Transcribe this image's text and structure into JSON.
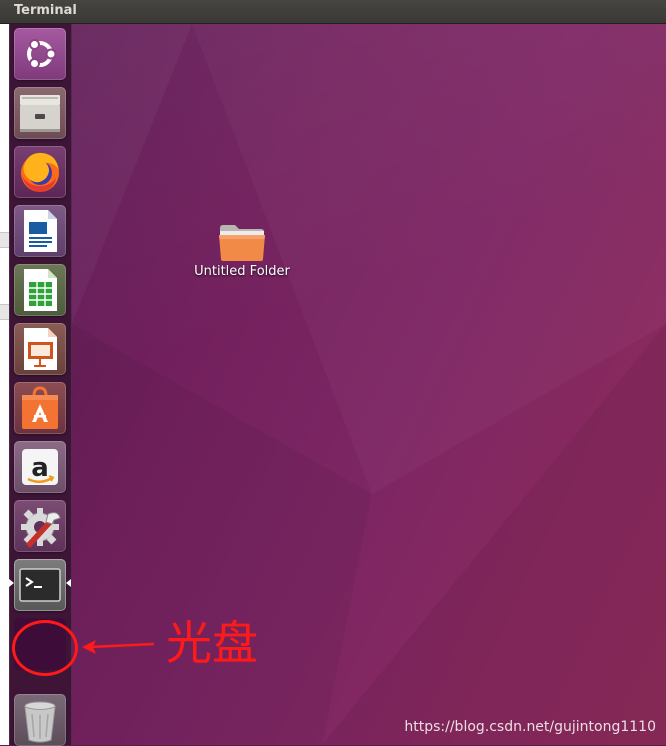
{
  "window": {
    "title": "Terminal"
  },
  "launcher": {
    "items": [
      {
        "name": "Search your computer",
        "icon": "ubuntu-dash-icon"
      },
      {
        "name": "Files",
        "icon": "file-cabinet-icon"
      },
      {
        "name": "Firefox Web Browser",
        "icon": "firefox-icon"
      },
      {
        "name": "LibreOffice Writer",
        "icon": "libreoffice-writer-icon"
      },
      {
        "name": "LibreOffice Calc",
        "icon": "libreoffice-calc-icon"
      },
      {
        "name": "LibreOffice Impress",
        "icon": "libreoffice-impress-icon"
      },
      {
        "name": "Ubuntu Software",
        "icon": "software-bag-icon"
      },
      {
        "name": "Amazon",
        "icon": "amazon-icon"
      },
      {
        "name": "System Settings",
        "icon": "settings-gear-wrench-icon"
      },
      {
        "name": "Terminal",
        "icon": "terminal-icon"
      },
      {
        "name": "Trash",
        "icon": "trash-icon"
      }
    ]
  },
  "desktop": {
    "folder": {
      "label": "Untitled Folder",
      "icon": "folder-icon"
    }
  },
  "annotation": {
    "text": "光盘",
    "color": "#ff1a1a"
  },
  "watermark": "https://blog.csdn.net/gujintong1110"
}
